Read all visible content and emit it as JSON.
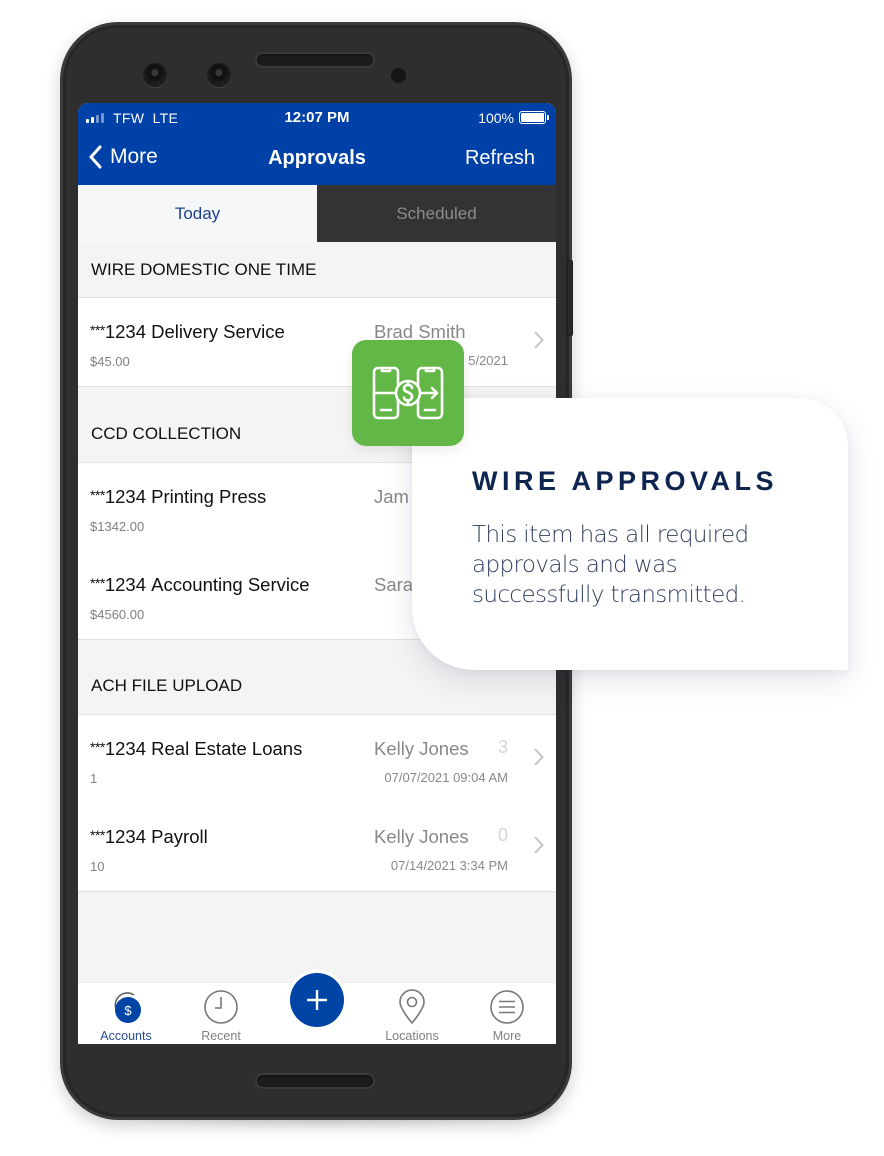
{
  "status_bar": {
    "carrier": "TFW",
    "network": "LTE",
    "time": "12:07 PM",
    "battery_percent": "100%",
    "battery_level": 1.0,
    "signal_bars_active": 2,
    "signal_bars_total": 4
  },
  "nav": {
    "back_label": "More",
    "title": "Approvals",
    "refresh_label": "Refresh"
  },
  "tabs": [
    {
      "label": "Today",
      "active": true
    },
    {
      "label": "Scheduled",
      "active": false
    }
  ],
  "sections": [
    {
      "title": "WIRE DOMESTIC ONE TIME",
      "items": [
        {
          "mask": "***",
          "account": "1234",
          "name": "Delivery Service",
          "sub": "$45.00",
          "person": "Brad Smith",
          "count": "",
          "date": "5/2021"
        }
      ]
    },
    {
      "title": "CCD COLLECTION",
      "items": [
        {
          "mask": "***",
          "account": "1234",
          "name": "Printing Press",
          "sub": "$1342.00",
          "person": "Jam",
          "count": "",
          "date": ""
        },
        {
          "mask": "***",
          "account": "1234",
          "name": "Accounting Service",
          "sub": "$4560.00",
          "person": "Sara",
          "count": "",
          "date": ""
        }
      ]
    },
    {
      "title": "ACH FILE UPLOAD",
      "items": [
        {
          "mask": "***",
          "account": "1234",
          "name": "Real Estate Loans",
          "sub": "1",
          "person": "Kelly Jones",
          "count": "3",
          "date": "07/07/2021 09:04 AM"
        },
        {
          "mask": "***",
          "account": "1234",
          "name": "Payroll",
          "sub": "10",
          "person": "Kelly Jones",
          "count": "0",
          "date": "07/14/2021 3:34 PM"
        }
      ]
    }
  ],
  "tabbar": {
    "items": [
      {
        "label": "Accounts",
        "icon": "accounts-dollar-icon",
        "active": true
      },
      {
        "label": "Recent",
        "icon": "clock-icon",
        "active": false
      },
      {
        "label": "",
        "icon": "plus-icon",
        "active": false
      },
      {
        "label": "Locations",
        "icon": "location-pin-icon",
        "active": false
      },
      {
        "label": "More",
        "icon": "menu-icon",
        "active": false
      }
    ]
  },
  "callout": {
    "badge_icon": "money-transfer-icon",
    "title": "WIRE APPROVALS",
    "body": "This item has all required approvals and was successfully transmitted."
  },
  "colors": {
    "brand_blue": "#0041a8",
    "tab_inactive_bg": "#333333",
    "badge_green": "#62b746",
    "callout_title": "#0e2550"
  }
}
